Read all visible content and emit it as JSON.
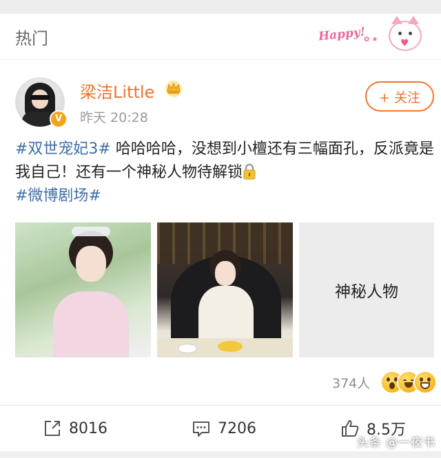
{
  "header": {
    "title": "热门",
    "deco_text": "Happy!"
  },
  "post": {
    "username": "梁洁Little",
    "timestamp": "昨天 20:28",
    "follow_label": "+ 关注",
    "verified_badge": "V",
    "text_hashtag1": "#双世宠妃3#",
    "text_body": " 哈哈哈哈，没想到小檀还有三幅面孔，反派竟是我自己！还有一个神秘人物待解锁",
    "text_hashtag2": "#微博剧场#",
    "mystery_label": "神秘人物",
    "icons": {
      "lock": "lock-icon",
      "crown": "crown-icon"
    }
  },
  "reactions": {
    "count": "374人",
    "emojis": [
      "surprised-emoji",
      "laughing-emoji",
      "grin-emoji"
    ]
  },
  "actions": {
    "repost_count": "8016",
    "comment_count": "7206",
    "like_count": "8.5万"
  },
  "watermark": "头条 @一夜书",
  "colors": {
    "accent_orange": "#f0742f",
    "hashtag_blue": "#3e6ea8",
    "muted_gray": "#9a9a9a"
  }
}
